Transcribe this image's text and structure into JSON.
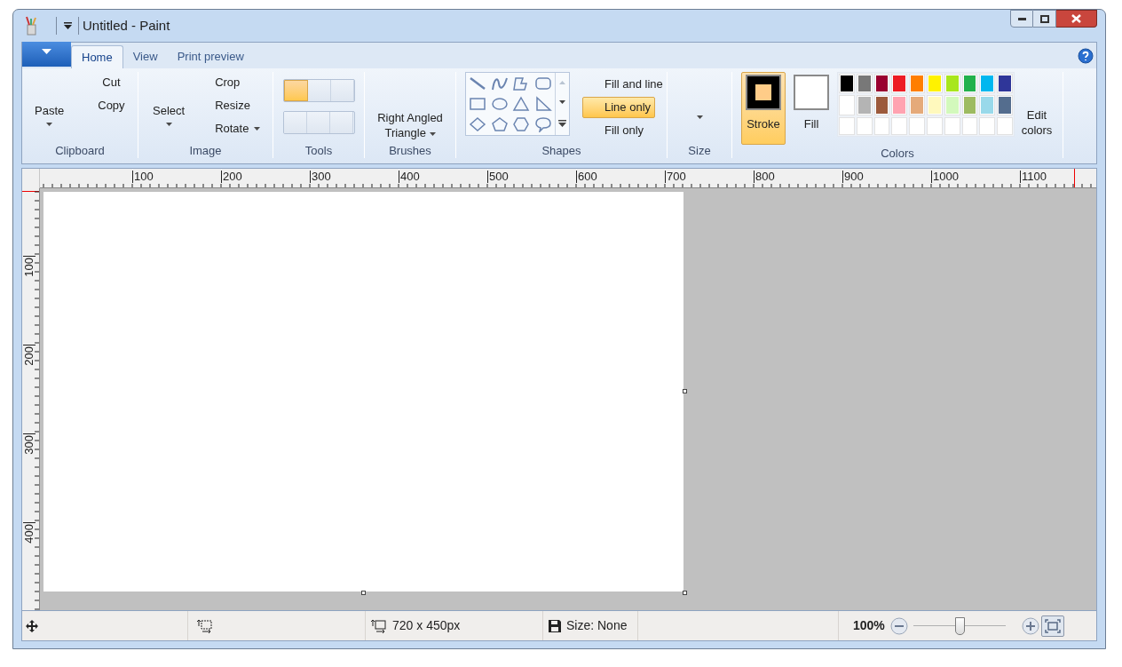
{
  "window": {
    "title": "Untitled - Paint"
  },
  "tabs": [
    {
      "label": "Home",
      "selected": true
    },
    {
      "label": "View",
      "selected": false
    },
    {
      "label": "Print preview",
      "selected": false
    }
  ],
  "clipboard": {
    "label": "Clipboard",
    "paste": "Paste",
    "cut": "Cut",
    "copy": "Copy"
  },
  "image": {
    "label": "Image",
    "select": "Select",
    "crop": "Crop",
    "resize": "Resize",
    "rotate": "Rotate"
  },
  "tools": {
    "label": "Tools",
    "buttons": [
      {
        "selected": true
      },
      {
        "selected": false
      },
      {
        "selected": false
      },
      {
        "selected": false
      },
      {
        "selected": false
      },
      {
        "selected": false
      }
    ]
  },
  "brushes": {
    "label": "Brushes",
    "current": "Right Angled Triangle"
  },
  "shapes": {
    "label": "Shapes",
    "styles": [
      {
        "label": "Fill and line",
        "selected": false
      },
      {
        "label": "Line only",
        "selected": true
      },
      {
        "label": "Fill only",
        "selected": false
      }
    ]
  },
  "size": {
    "label": "Size"
  },
  "colors": {
    "label": "Colors",
    "stroke": {
      "label": "Stroke",
      "selected": true,
      "color": "#ffcc88"
    },
    "fill": {
      "label": "Fill",
      "selected": false,
      "color": "#ffffff"
    },
    "edit": "Edit colors",
    "palette": [
      {
        "kind": "swatch",
        "color": "#000000"
      },
      {
        "kind": "swatch",
        "color": "#787878"
      },
      {
        "kind": "swatch",
        "color": "#990030"
      },
      {
        "kind": "swatch",
        "color": "#ed1c24"
      },
      {
        "kind": "swatch",
        "color": "#ff7e00"
      },
      {
        "kind": "swatch",
        "color": "#fff200"
      },
      {
        "kind": "swatch",
        "color": "#a8e61d"
      },
      {
        "kind": "swatch",
        "color": "#22b14c"
      },
      {
        "kind": "swatch",
        "color": "#00b7ef"
      },
      {
        "kind": "swatch",
        "color": "#2f3699"
      },
      {
        "kind": "swatch",
        "color": "#ffffff"
      },
      {
        "kind": "swatch",
        "color": "#b4b4b4"
      },
      {
        "kind": "swatch",
        "color": "#9c5a3c"
      },
      {
        "kind": "swatch",
        "color": "#ffa3b1"
      },
      {
        "kind": "swatch",
        "color": "#e5aa7a"
      },
      {
        "kind": "swatch",
        "color": "#fff9bd"
      },
      {
        "kind": "swatch",
        "color": "#d3f9bc"
      },
      {
        "kind": "swatch",
        "color": "#9dbb61"
      },
      {
        "kind": "swatch",
        "color": "#99d9ea"
      },
      {
        "kind": "swatch",
        "color": "#546d8e"
      },
      {
        "kind": "empty"
      },
      {
        "kind": "empty"
      },
      {
        "kind": "empty"
      },
      {
        "kind": "empty"
      },
      {
        "kind": "empty"
      },
      {
        "kind": "empty"
      },
      {
        "kind": "empty"
      },
      {
        "kind": "empty"
      },
      {
        "kind": "empty"
      },
      {
        "kind": "empty"
      }
    ]
  },
  "rulers": {
    "horizontal": [
      "100",
      "200",
      "300",
      "400",
      "500",
      "600",
      "700",
      "800",
      "900",
      "1000",
      "1100"
    ],
    "vertical": [
      "100",
      "200",
      "300",
      "400"
    ]
  },
  "status_bar": {
    "dimensions": "720 x 450px",
    "file_size": "Size: None",
    "zoom": "100%",
    "zoom_level": {
      "level": 0.5
    }
  }
}
